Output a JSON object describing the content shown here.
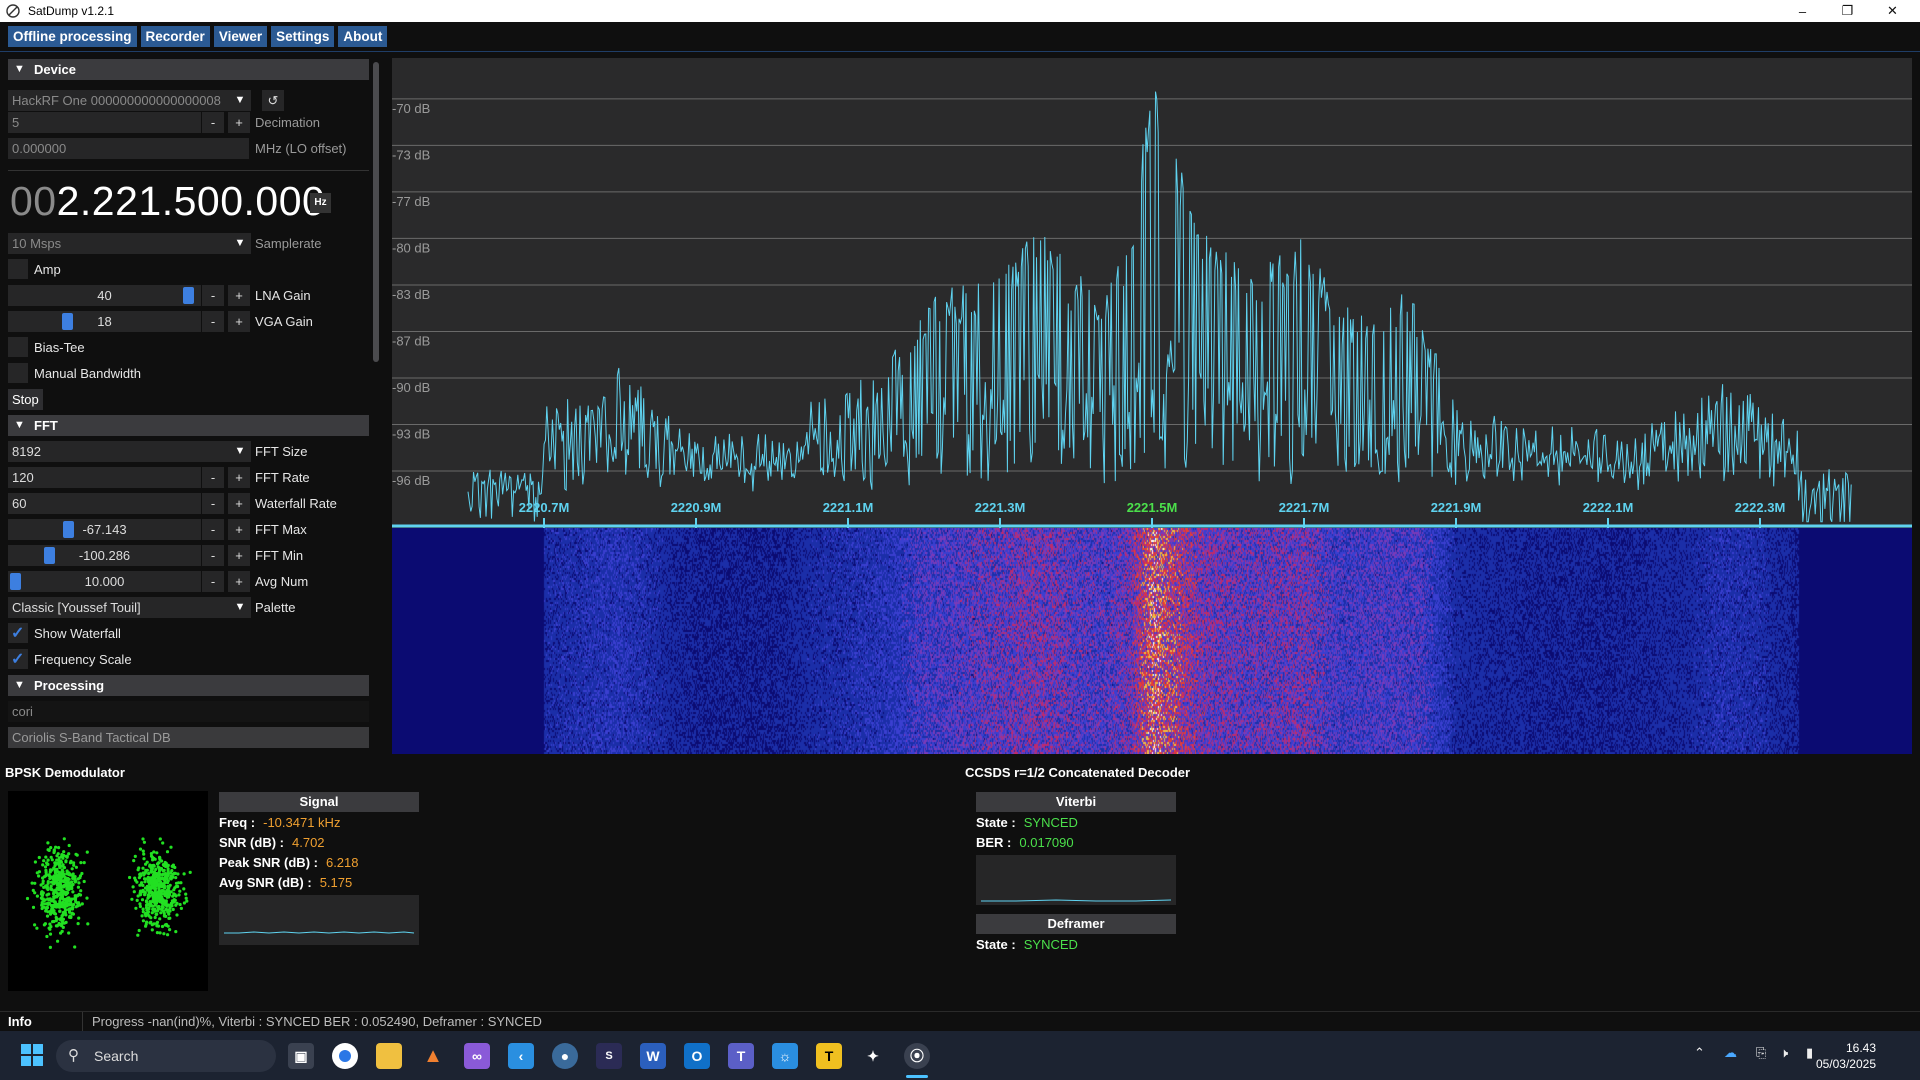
{
  "window": {
    "title": "SatDump v1.2.1"
  },
  "menu": {
    "tabs": [
      "Offline processing",
      "Recorder",
      "Viewer",
      "Settings",
      "About"
    ]
  },
  "device": {
    "header": "Device",
    "device_name": "HackRF One 000000000000000008",
    "decimation_value": "5",
    "decimation_label": "Decimation",
    "lo_offset_value": "0.000000",
    "lo_offset_label": "MHz (LO offset)",
    "frequency_lead": "00",
    "frequency_main": "2.221.500.000",
    "frequency_unit": "Hz",
    "samplerate_value": "10 Msps",
    "samplerate_label": "Samplerate",
    "amp_label": "Amp",
    "lna_gain_value": "40",
    "lna_gain_fraction": 0.97,
    "lna_gain_label": "LNA Gain",
    "vga_gain_value": "18",
    "vga_gain_fraction": 0.29,
    "vga_gain_label": "VGA Gain",
    "bias_tee_label": "Bias-Tee",
    "manual_bw_label": "Manual Bandwidth",
    "stop_label": "Stop"
  },
  "fft": {
    "header": "FFT",
    "size_value": "8192",
    "size_label": "FFT Size",
    "rate_value": "120",
    "rate_label": "FFT Rate",
    "wf_rate_value": "60",
    "wf_rate_label": "Waterfall Rate",
    "max_value": "-67.143",
    "max_fraction": 0.3,
    "max_label": "FFT Max",
    "min_value": "-100.286",
    "min_fraction": 0.19,
    "min_label": "FFT Min",
    "avg_value": "10.000",
    "avg_fraction": 0.0,
    "avg_label": "Avg Num",
    "palette_value": "Classic [Youssef Touil]",
    "palette_label": "Palette",
    "show_waterfall_label": "Show Waterfall",
    "freq_scale_label": "Frequency Scale"
  },
  "processing": {
    "header": "Processing",
    "search_value": "cori",
    "pipeline_value": "Coriolis S-Band Tactical DB"
  },
  "chart_data": {
    "type": "line",
    "title": "",
    "xlabel": "",
    "ylabel": "",
    "x_unit": "MHz",
    "y_unit": "dB",
    "y_ticks": [
      "-70 dB",
      "-73 dB",
      "-77 dB",
      "-80 dB",
      "-83 dB",
      "-87 dB",
      "-90 dB",
      "-93 dB",
      "-96 dB"
    ],
    "x_ticks": [
      "2220.7M",
      "2220.9M",
      "2221.1M",
      "2221.3M",
      "2221.5M",
      "2221.7M",
      "2221.9M",
      "2222.1M",
      "2222.3M"
    ],
    "center_tick": "2221.5M",
    "xlim": [
      2220.5,
      2222.5
    ],
    "ylim": [
      -100.3,
      -67.1
    ],
    "series": [
      {
        "values_peaks": [
          [
            2220.7,
            -91.5
          ],
          [
            2220.8,
            -89.0
          ],
          [
            2220.9,
            -93.5
          ],
          [
            2221.0,
            -93.8
          ],
          [
            2221.05,
            -91.5
          ],
          [
            2221.1,
            -90.5
          ],
          [
            2221.15,
            -88.8
          ],
          [
            2221.2,
            -84.5
          ],
          [
            2221.25,
            -83.0
          ],
          [
            2221.3,
            -81.5
          ],
          [
            2221.33,
            -80.0
          ],
          [
            2221.36,
            -79.5
          ],
          [
            2221.4,
            -82.5
          ],
          [
            2221.44,
            -83.0
          ],
          [
            2221.47,
            -80.5
          ],
          [
            2221.5,
            -68.3
          ],
          [
            2221.56,
            -78.5
          ],
          [
            2221.6,
            -80.8
          ],
          [
            2221.65,
            -81.5
          ],
          [
            2221.7,
            -79.8
          ],
          [
            2221.75,
            -85.0
          ],
          [
            2221.8,
            -83.5
          ],
          [
            2221.85,
            -84.0
          ],
          [
            2221.9,
            -91.5
          ],
          [
            2222.0,
            -93.0
          ],
          [
            2222.1,
            -93.5
          ],
          [
            2222.2,
            -92.0
          ],
          [
            2222.25,
            -90.0
          ],
          [
            2222.3,
            -91.0
          ],
          [
            2222.35,
            -93.5
          ]
        ]
      }
    ]
  },
  "demod": {
    "title": "BPSK Demodulator",
    "signal_header": "Signal",
    "freq_label": "Freq :",
    "freq_value": "-10.3471 kHz",
    "snr_label": "SNR (dB) :",
    "snr_value": "4.702",
    "peak_snr_label": "Peak SNR (dB) :",
    "peak_snr_value": "6.218",
    "avg_snr_label": "Avg SNR (dB) :",
    "avg_snr_value": "5.175"
  },
  "decoder": {
    "title": "CCSDS r=1/2 Concatenated Decoder",
    "viterbi_header": "Viterbi",
    "state_label": "State :",
    "state_value": "SYNCED",
    "ber_label": "BER   :",
    "ber_value": "0.017090",
    "deframer_header": "Deframer",
    "deframer_state_label": "State :",
    "deframer_state_value": "SYNCED"
  },
  "info": {
    "label": "Info",
    "text": "Progress -nan(ind)%, Viterbi : SYNCED BER : 0.052490, Deframer : SYNCED"
  },
  "taskbar": {
    "search_placeholder": "Search",
    "time": "16.43",
    "date": "05/03/2025"
  },
  "colors": {
    "accent": "#2b5a93",
    "spectrum_line": "#5fd3f0",
    "synced": "#4be04b",
    "value_orange": "#f0a030"
  }
}
